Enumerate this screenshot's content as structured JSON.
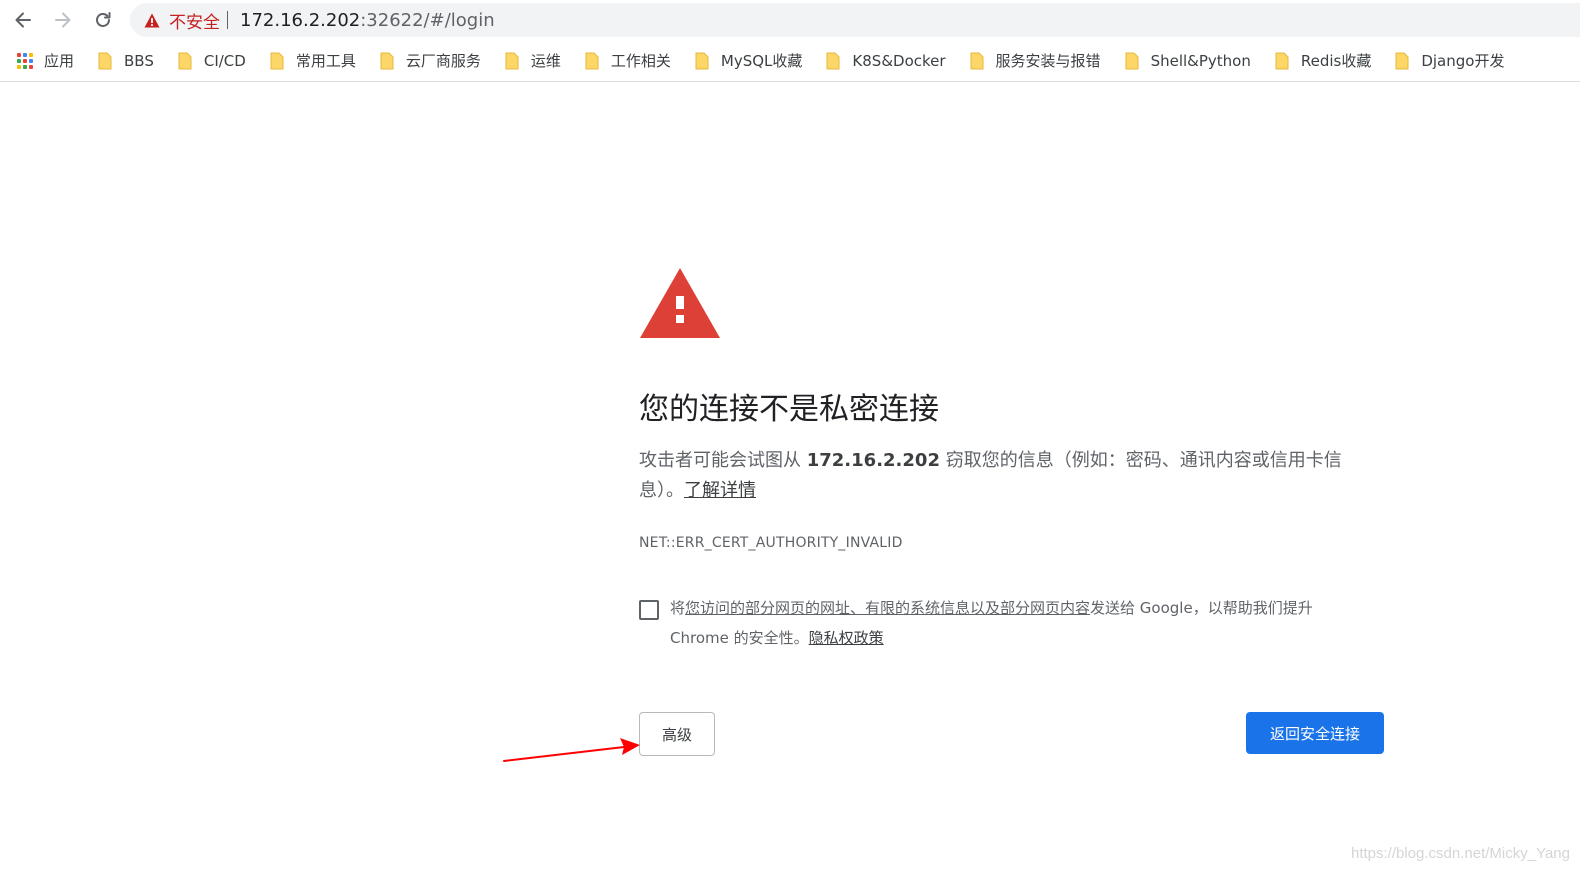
{
  "omnibox": {
    "security_label": "不安全",
    "url_host": "172.16.2.202",
    "url_rest": ":32622/#/login"
  },
  "bookmarks": [
    {
      "label": "应用",
      "icon": "apps-icon"
    },
    {
      "label": "BBS",
      "icon": "folder-icon"
    },
    {
      "label": "CI/CD",
      "icon": "folder-icon"
    },
    {
      "label": "常用工具",
      "icon": "folder-icon"
    },
    {
      "label": "云厂商服务",
      "icon": "folder-icon"
    },
    {
      "label": "运维",
      "icon": "folder-icon"
    },
    {
      "label": "工作相关",
      "icon": "folder-icon"
    },
    {
      "label": "MySQL收藏",
      "icon": "folder-icon"
    },
    {
      "label": "K8S&Docker",
      "icon": "folder-icon"
    },
    {
      "label": "服务安装与报错",
      "icon": "folder-icon"
    },
    {
      "label": "Shell&Python",
      "icon": "folder-icon"
    },
    {
      "label": "Redis收藏",
      "icon": "folder-icon"
    },
    {
      "label": "Django开发",
      "icon": "folder-icon"
    }
  ],
  "interstitial": {
    "heading": "您的连接不是私密连接",
    "explain_before": "攻击者可能会试图从 ",
    "explain_host": "172.16.2.202",
    "explain_after": " 窃取您的信息（例如：密码、通讯内容或信用卡信息）。",
    "learn_more": "了解详情",
    "error_code": "NET::ERR_CERT_AUTHORITY_INVALID",
    "optin_prefix": "将",
    "optin_link": "您访问的部分网页的网址、有限的系统信息以及部分网页内容",
    "optin_middle": "发送给 Google，以帮助我们提升 Chrome 的安全性。",
    "privacy_link": "隐私权政策",
    "advanced_button": "高级",
    "back_button": "返回安全连接"
  },
  "watermark": "https://blog.csdn.net/Micky_Yang",
  "colors": {
    "danger": "#c5221f",
    "warning_red": "#dc4037",
    "primary_blue": "#1a73e8",
    "folder_yellow": "#fcd667",
    "annotation_arrow": "#ff0000"
  }
}
